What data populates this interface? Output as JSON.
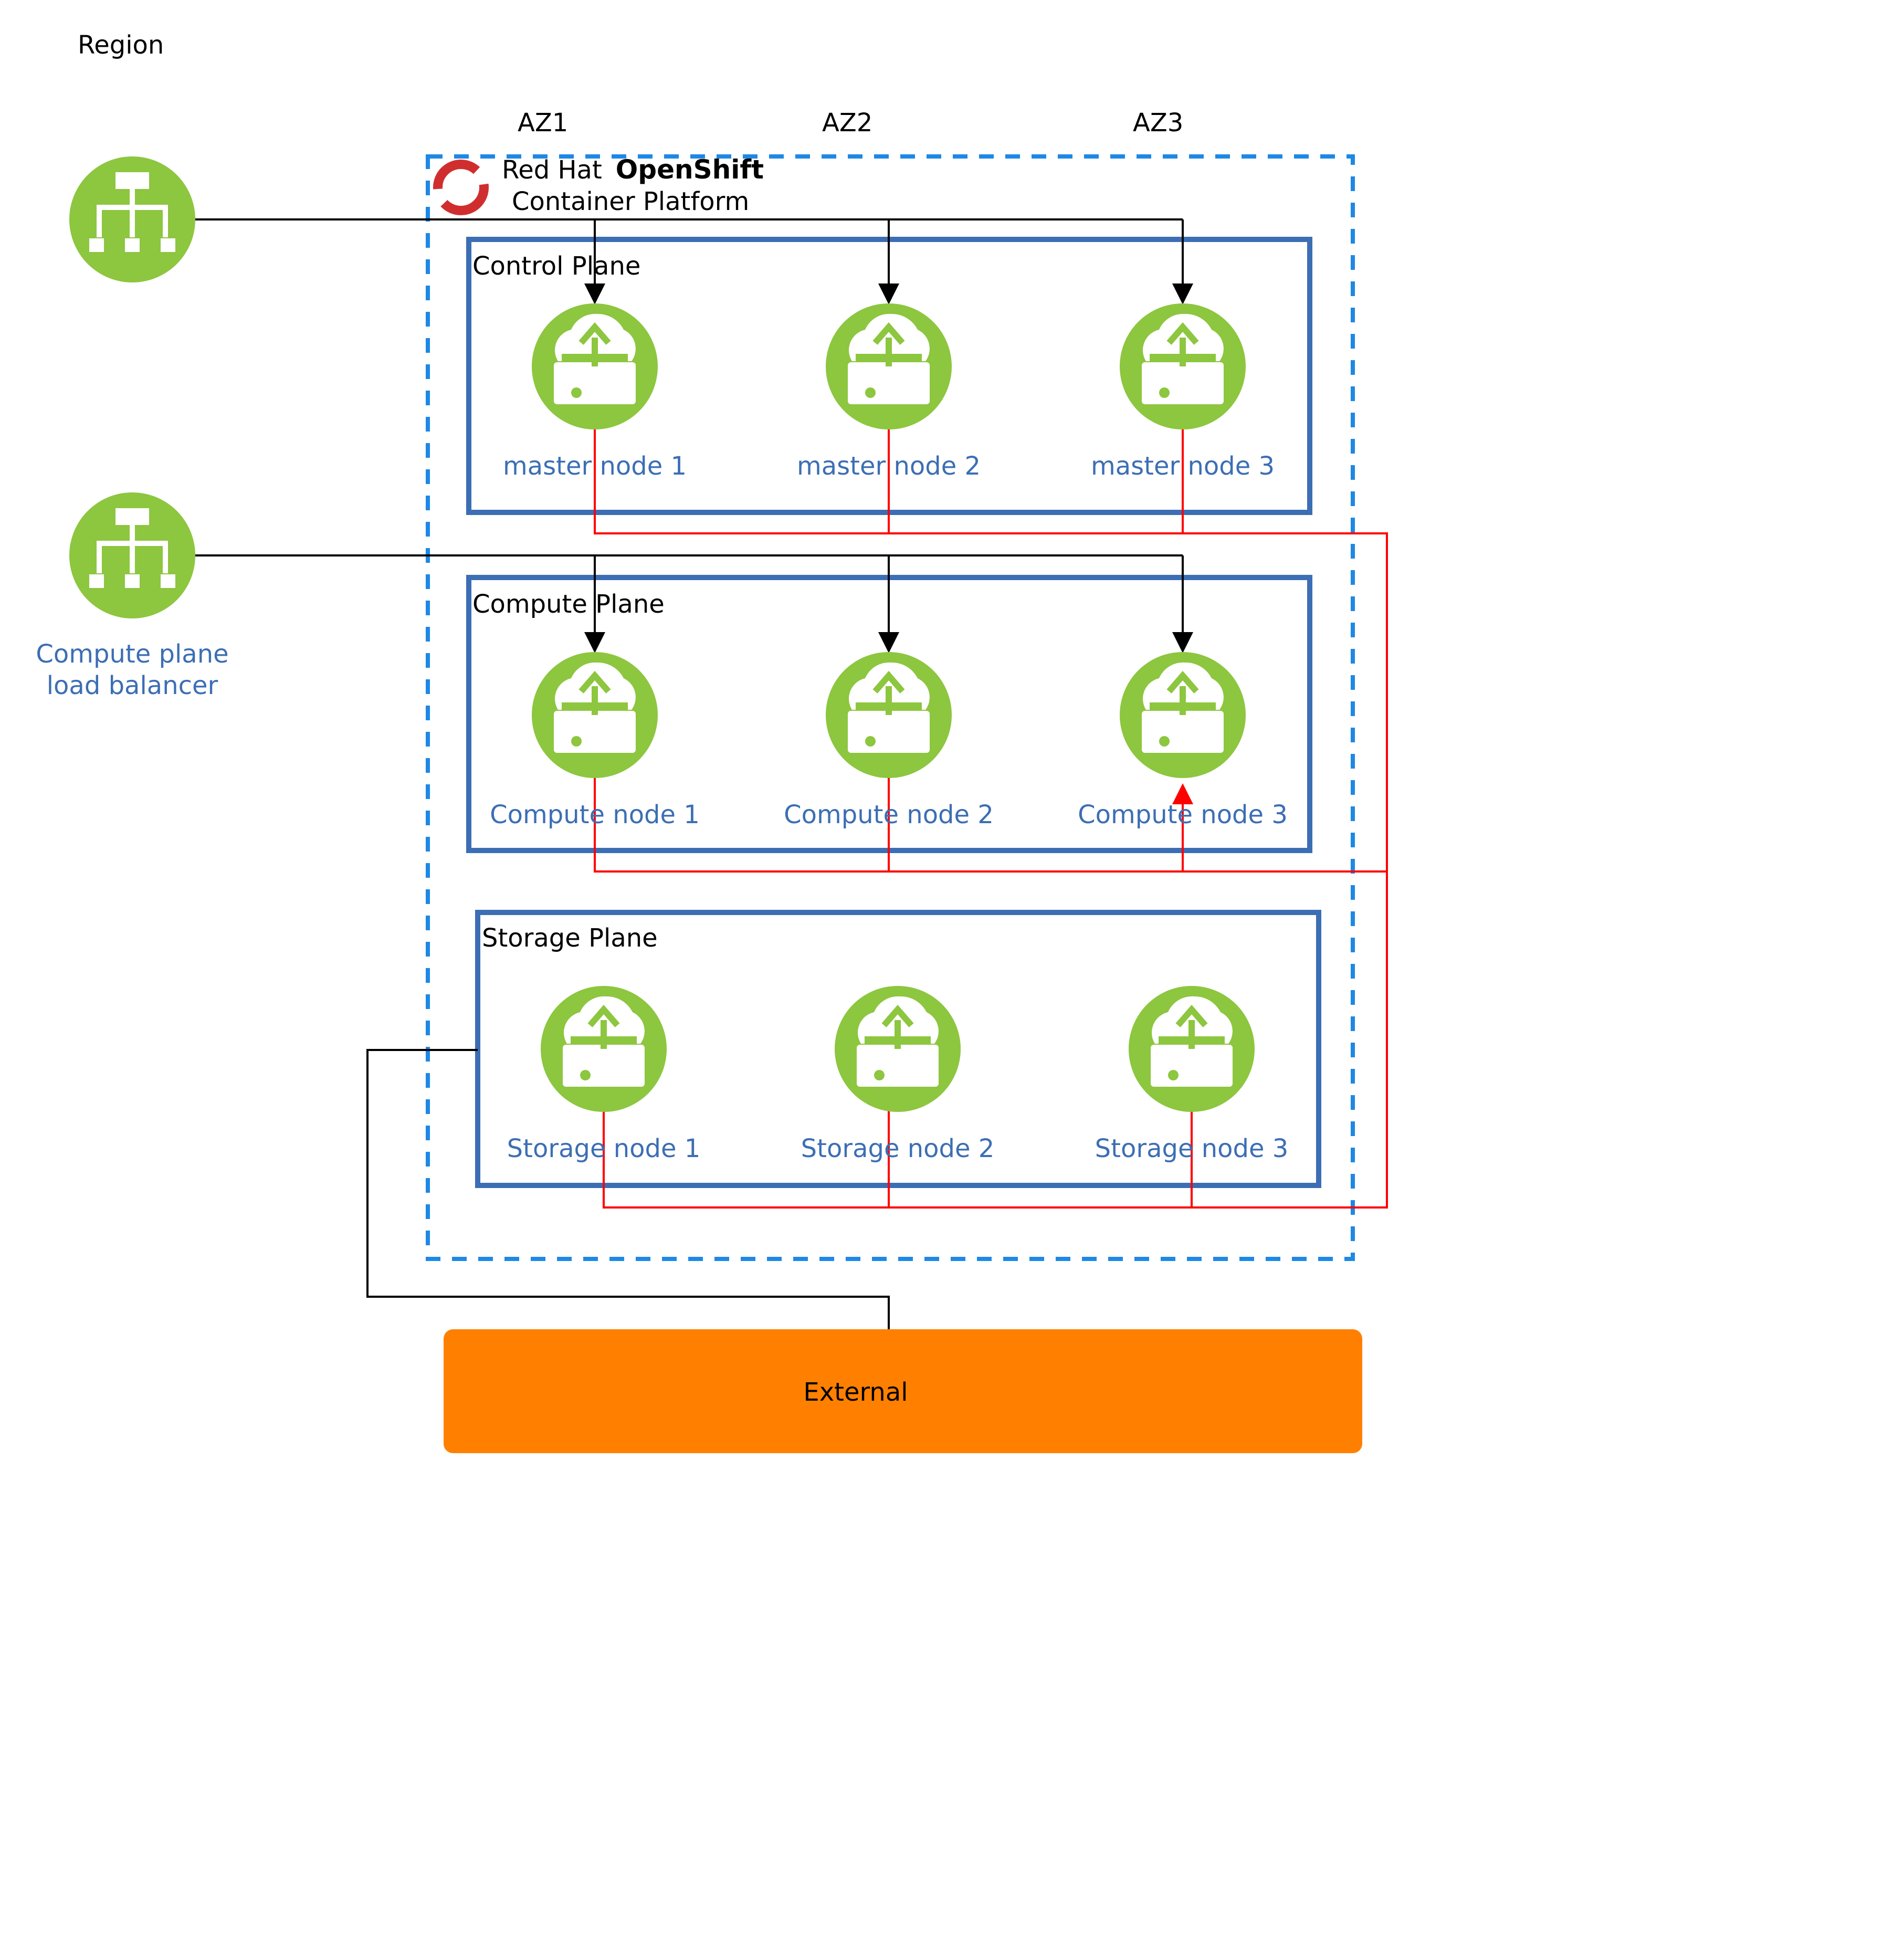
{
  "region_label": "Region",
  "availability_zones": [
    "AZ1",
    "AZ2",
    "AZ3"
  ],
  "platform": {
    "brand_regular": "Red Hat",
    "brand_bold": "OpenShift",
    "subtitle": "Container Platform"
  },
  "planes": {
    "control": {
      "title": "Control Plane",
      "nodes": [
        "master node 1",
        "master node 2",
        "master node 3"
      ]
    },
    "compute": {
      "title": "Compute Plane",
      "nodes": [
        "Compute node 1",
        "Compute node 2",
        "Compute node 3"
      ]
    },
    "storage": {
      "title": "Storage Plane",
      "nodes": [
        "Storage node 1",
        "Storage node 2",
        "Storage node 3"
      ]
    }
  },
  "load_balancers": {
    "compute_line1": "Compute plane",
    "compute_line2": "load balancer"
  },
  "external_label": "External",
  "colors": {
    "node_green": "#8DC63F",
    "plane_border": "#3C6EB4",
    "platform_border": "#1E88E5",
    "network_red": "#FF0000",
    "external_orange": "#FF8000",
    "openshift_red": "#D02E2E"
  },
  "icons": {
    "load_balancer": "hierarchy-icon",
    "node": "cloud-upload-server-icon",
    "platform": "openshift-logo"
  }
}
